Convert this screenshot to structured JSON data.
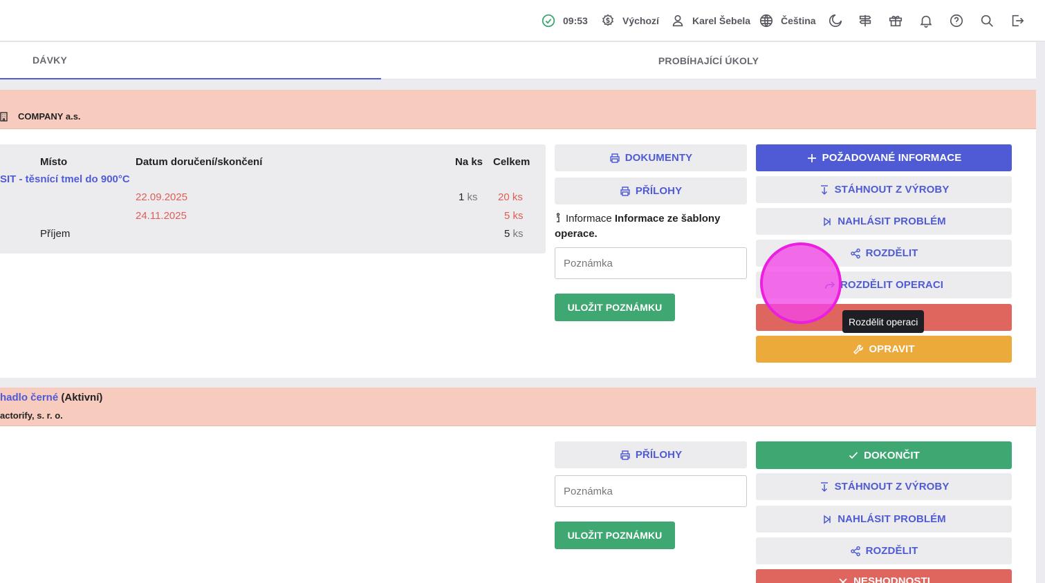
{
  "topbar": {
    "time": "09:53",
    "currency": "Výchozí",
    "user": "Karel Šebela",
    "language": "Čeština"
  },
  "tabs": [
    {
      "label": "DÁVKY"
    },
    {
      "label": "PROBÍHAJÍCÍ ÚKOLY"
    }
  ],
  "card1": {
    "company": "COMPANY a.s.",
    "table": {
      "headers": [
        "Místo",
        "Datum doručení/skončení",
        "Na ks",
        "Celkem"
      ],
      "product": "SIT - těsnící tmel do 900°C",
      "rows": [
        {
          "date": "22.09.2025",
          "na_ks": "1",
          "na_ks_unit": "ks",
          "total": "20",
          "total_unit": "ks"
        },
        {
          "date": "24.11.2025",
          "total": "5",
          "total_unit": "ks"
        },
        {
          "place": "Příjem",
          "total": "5",
          "total_unit": "ks"
        }
      ]
    },
    "buttons": {
      "documents": "DOKUMENTY",
      "attachments": "PŘÍLOHY",
      "save_note": "ULOŽIT POZNÁMKU",
      "required_info": "POŽADOVANÉ INFORMACE",
      "pull": "STÁHNOUT Z VÝROBY",
      "report": "NAHLÁSIT PROBLÉM",
      "split": "ROZDĚLIT",
      "split_op": "ROZDĚLIT OPERACI",
      "fix": "OPRAVIT"
    },
    "info_label": "Informace",
    "info_text": "Informace ze šablony operace.",
    "note_placeholder": "Poznámka",
    "tooltip": "Rozdělit operaci"
  },
  "card2": {
    "product": "hadlo černé",
    "status": "(Aktivní)",
    "company": "actorify, s. r. o.",
    "buttons": {
      "attachments": "PŘÍLOHY",
      "save_note": "ULOŽIT POZNÁMKU",
      "finish": "DOKONČIT",
      "pull": "STÁHNOUT Z VÝROBY",
      "report": "NAHLÁSIT PROBLÉM",
      "split": "ROZDĚLIT",
      "discrepancies": "NESHODNOSTI"
    },
    "note_placeholder": "Poznámka"
  },
  "colors": {
    "primary": "#4f5bd5",
    "green": "#3fa772",
    "red": "#df665f",
    "orange": "#ecaa3a",
    "header_bg": "#f7cbbd"
  }
}
